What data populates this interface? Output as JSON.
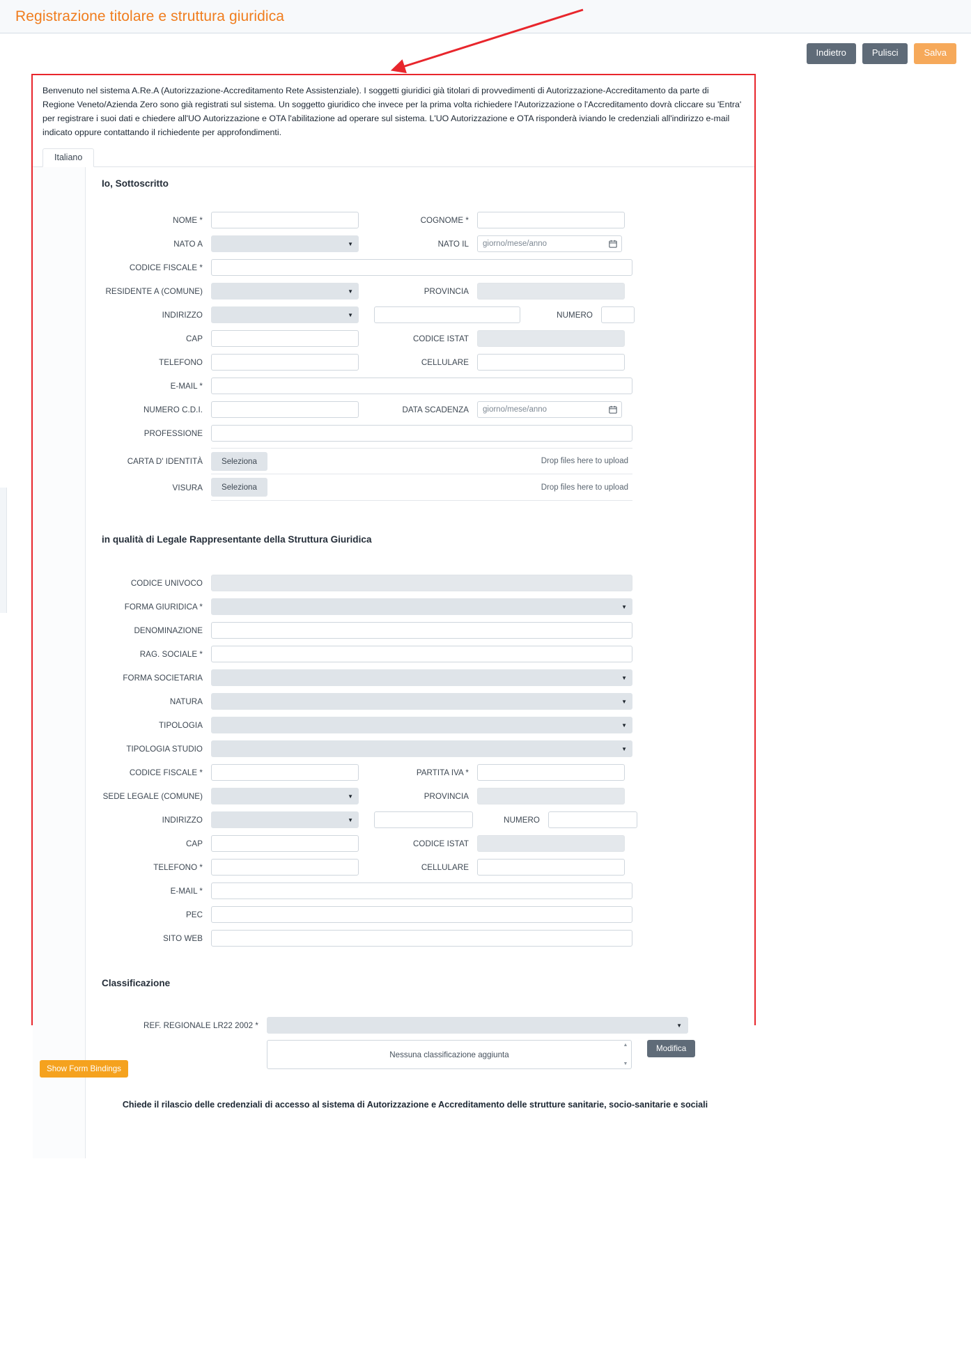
{
  "header": {
    "title": "Registrazione titolare e struttura giuridica"
  },
  "toolbar": {
    "back_label": "Indietro",
    "clear_label": "Pulisci",
    "save_label": "Salva"
  },
  "intro": {
    "text": "Benvenuto nel sistema A.Re.A (Autorizzazione-Accreditamento Rete Assistenziale). I soggetti giuridici già titolari di provvedimenti di Autorizzazione-Accreditamento da parte di Regione Veneto/Azienda Zero sono già registrati sul sistema. Un soggetto giuridico che invece per la prima volta richiedere l'Autorizzazione o l'Accreditamento dovrà cliccare su 'Entra' per registrare i suoi dati e chiedere all'UO Autorizzazione e OTA l'abilitazione ad operare sul sistema. L'UO Autorizzazione e OTA risponderà iviando le credenziali all'indirizzo e-mail indicato oppure contattando il richiedente per approfondimenti."
  },
  "tabs": [
    {
      "label": "Italiano"
    }
  ],
  "sections": {
    "person": {
      "title": "Io, Sottoscritto",
      "rows": [
        {
          "left_label": "NOME *",
          "left_type": "text",
          "right_label": "COGNOME *",
          "right_type": "text"
        },
        {
          "left_label": "NATO A",
          "left_type": "select",
          "right_label": "NATO IL",
          "right_type": "date",
          "right_placeholder": "giorno/mese/anno"
        },
        {
          "left_label": "CODICE FISCALE *",
          "left_type": "full"
        },
        {
          "left_label": "RESIDENTE A (COMUNE)",
          "left_type": "select",
          "right_label": "PROVINCIA",
          "right_type": "readonly"
        },
        {
          "left_label": "INDIRIZZO",
          "left_type": "select",
          "right_label": "NUMERO",
          "right_type": "numero"
        },
        {
          "left_label": "CAP",
          "left_type": "text",
          "right_label": "CODICE ISTAT",
          "right_type": "readonly"
        },
        {
          "left_label": "TELEFONO",
          "left_type": "text",
          "right_label": "CELLULARE",
          "right_type": "text"
        },
        {
          "left_label": "E-MAIL *",
          "left_type": "full"
        },
        {
          "left_label": "NUMERO C.D.I.",
          "left_type": "text",
          "right_label": "DATA SCADENZA",
          "right_type": "date",
          "right_placeholder": "giorno/mese/anno"
        },
        {
          "left_label": "PROFESSIONE",
          "left_type": "full"
        }
      ],
      "uploads": [
        {
          "label": "CARTA D' IDENTITÀ",
          "button": "Seleziona",
          "hint": "Drop files here to upload"
        },
        {
          "label": "VISURA",
          "button": "Seleziona",
          "hint": "Drop files here to upload"
        }
      ]
    },
    "entity": {
      "title": "in qualità di Legale Rappresentante della Struttura Giuridica",
      "rows": [
        {
          "left_label": "CODICE UNIVOCO",
          "left_type": "full-ro"
        },
        {
          "left_label": "FORMA GIURIDICA *",
          "left_type": "select-wide"
        },
        {
          "left_label": "DENOMINAZIONE",
          "left_type": "full"
        },
        {
          "left_label": "RAG. SOCIALE *",
          "left_type": "full"
        },
        {
          "left_label": "FORMA SOCIETARIA",
          "left_type": "select-wide"
        },
        {
          "left_label": "NATURA",
          "left_type": "select-wide"
        },
        {
          "left_label": "TIPOLOGIA",
          "left_type": "select-wide"
        },
        {
          "left_label": "TIPOLOGIA STUDIO",
          "left_type": "select-wide"
        },
        {
          "left_label": "CODICE FISCALE *",
          "left_type": "text",
          "right_label": "PARTITA IVA *",
          "right_type": "text"
        },
        {
          "left_label": "SEDE LEGALE (COMUNE)",
          "left_type": "select",
          "right_label": "PROVINCIA",
          "right_type": "readonly"
        },
        {
          "left_label": "INDIRIZZO",
          "left_type": "select",
          "right_label": "NUMERO",
          "right_type": "numero2"
        },
        {
          "left_label": "CAP",
          "left_type": "text",
          "right_label": "CODICE ISTAT",
          "right_type": "readonly"
        },
        {
          "left_label": "TELEFONO *",
          "left_type": "text",
          "right_label": "CELLULARE",
          "right_type": "text"
        },
        {
          "left_label": "E-MAIL *",
          "left_type": "full"
        },
        {
          "left_label": "PEC",
          "left_type": "full"
        },
        {
          "left_label": "SITO WEB",
          "left_type": "full"
        }
      ]
    },
    "classification": {
      "title": "Classificazione",
      "ref_label": "REF. REGIONALE LR22 2002 *",
      "empty_text": "Nessuna classificazione aggiunta",
      "edit_label": "Modifica"
    }
  },
  "closing_text": "Chiede il rilascio delle credenziali di accesso al sistema di Autorizzazione e Accreditamento delle strutture sanitarie, socio-sanitarie e sociali",
  "bottom": {
    "bindings_label": "Show Form Bindings"
  },
  "colors": {
    "title_orange": "#f07d1e",
    "button_grey": "#5f6b78",
    "button_orange": "#f6a95a",
    "highlight_red": "#e8262c",
    "field_grey": "#dfe4e9",
    "readonly_grey": "#e4e8ec"
  }
}
